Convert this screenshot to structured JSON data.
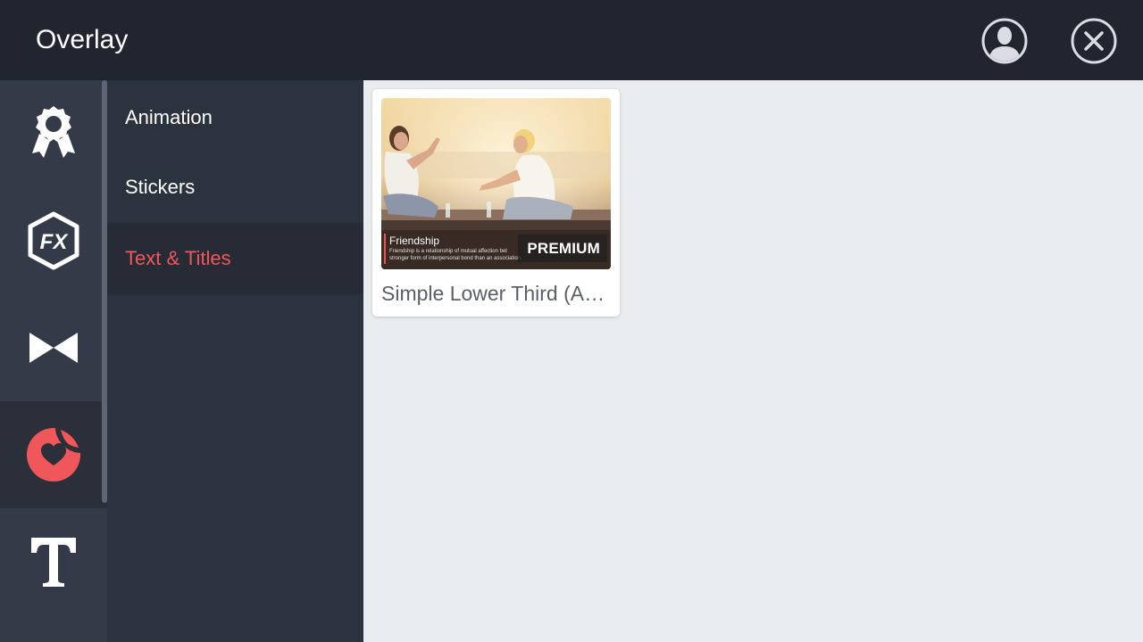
{
  "header": {
    "title": "Overlay",
    "account_icon": "account-icon",
    "close_icon": "close-icon"
  },
  "rail": {
    "items": [
      {
        "icon": "award-badge-icon",
        "selected": false
      },
      {
        "icon": "fx-icon",
        "selected": false
      },
      {
        "icon": "bowtie-transition-icon",
        "selected": false
      },
      {
        "icon": "heart-sticker-icon",
        "selected": true
      },
      {
        "icon": "text-t-icon",
        "selected": false
      }
    ]
  },
  "submenu": {
    "items": [
      {
        "label": "Animation",
        "active": false
      },
      {
        "label": "Stickers",
        "active": false
      },
      {
        "label": "Text & Titles",
        "active": true
      }
    ]
  },
  "content": {
    "cards": [
      {
        "label": "Simple Lower Third (A…",
        "badge": "PREMIUM",
        "overlay_title": "Friendship",
        "overlay_desc_1": "Friendship is a relationship of mutual affection bet",
        "overlay_desc_2": "stronger form of interpersonal bond than an association."
      }
    ]
  },
  "colors": {
    "topbar": "#212530",
    "rail": "#343a48",
    "submenu": "#2d333e",
    "accent": "#f0575a",
    "content_bg": "#e8ecef"
  }
}
